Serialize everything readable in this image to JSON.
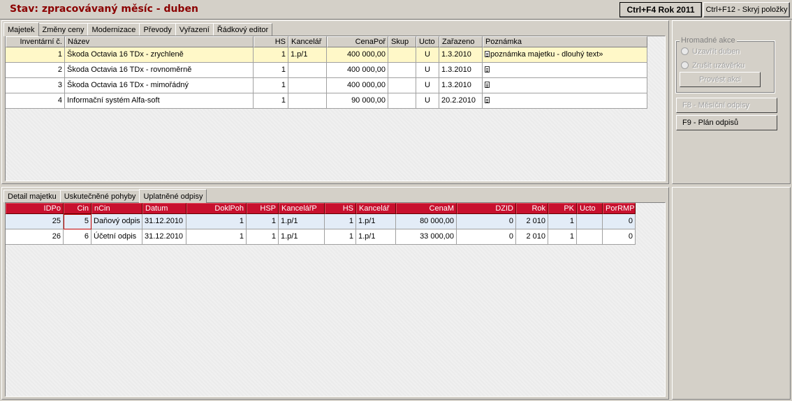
{
  "header": {
    "title": "Stav: zpracovávaný měsíc - duben",
    "btn_year": "Ctrl+F4 Rok 2011",
    "btn_hide": "Ctrl+F12 - Skryj položky"
  },
  "top_tabs": [
    "Majetek",
    "Změny ceny",
    "Modernizace",
    "Převody",
    "Vyřazení",
    "Řádkový editor"
  ],
  "assets": {
    "columns": [
      "Inventární č.",
      "Název",
      "HS",
      "Kancelář",
      "CenaPoř",
      "Skup",
      "Ucto",
      "Zařazeno",
      "Poznámka"
    ],
    "rows": [
      {
        "inv": "1",
        "name": "Škoda Octavia 16 TDx - zrychleně",
        "hs": "1",
        "office": "1.p/1",
        "price": "400 000,00",
        "group": "",
        "ucto": "U",
        "date": "1.3.2010",
        "note": "poznámka majetku - dlouhý text»"
      },
      {
        "inv": "2",
        "name": "Škoda Octavia 16 TDx - rovnoměrně",
        "hs": "1",
        "office": "",
        "price": "400 000,00",
        "group": "",
        "ucto": "U",
        "date": "1.3.2010",
        "note": ""
      },
      {
        "inv": "3",
        "name": "Škoda Octavia 16 TDx - mimořádný",
        "hs": "1",
        "office": "",
        "price": "400 000,00",
        "group": "",
        "ucto": "U",
        "date": "1.3.2010",
        "note": ""
      },
      {
        "inv": "4",
        "name": "Informační systém Alfa-soft",
        "hs": "1",
        "office": "",
        "price": "90 000,00",
        "group": "",
        "ucto": "U",
        "date": "20.2.2010",
        "note": ""
      }
    ]
  },
  "bottom_tabs": [
    "Detail majetku",
    "Uskutečněné pohyby",
    "Uplatněné odpisy"
  ],
  "depreciation": {
    "columns": [
      "IDPo",
      "Cin",
      "nCin",
      "Datum",
      "DoklPoh",
      "HSP",
      "KancelářP",
      "HS",
      "Kancelář",
      "CenaM",
      "DZID",
      "Rok",
      "PK",
      "Ucto",
      "PorRMP"
    ],
    "rows": [
      {
        "idpo": "25",
        "cin": "5",
        "ncin": "Daňový odpis",
        "date": "31.12.2010",
        "doklpoh": "1",
        "hsp": "1",
        "officep": "1.p/1",
        "hs": "1",
        "office": "1.p/1",
        "cenam": "80 000,00",
        "dzid": "0",
        "rok": "2 010",
        "pk": "1",
        "ucto": "",
        "porrmp": "0"
      },
      {
        "idpo": "26",
        "cin": "6",
        "ncin": "Účetní odpis",
        "date": "31.12.2010",
        "doklpoh": "1",
        "hsp": "1",
        "officep": "1.p/1",
        "hs": "1",
        "office": "1.p/1",
        "cenam": "33 000,00",
        "dzid": "0",
        "rok": "2 010",
        "pk": "1",
        "ucto": "",
        "porrmp": "0"
      }
    ]
  },
  "side": {
    "group_title": "Hromadné akce",
    "radio_close": "Uzavřít duben",
    "radio_cancel": "Zrušit uzávěrku",
    "btn_execute": "Provést akci",
    "btn_f8": "F8 - Měsíční odpisy",
    "btn_f9": "F9 - Plán odpisů"
  }
}
